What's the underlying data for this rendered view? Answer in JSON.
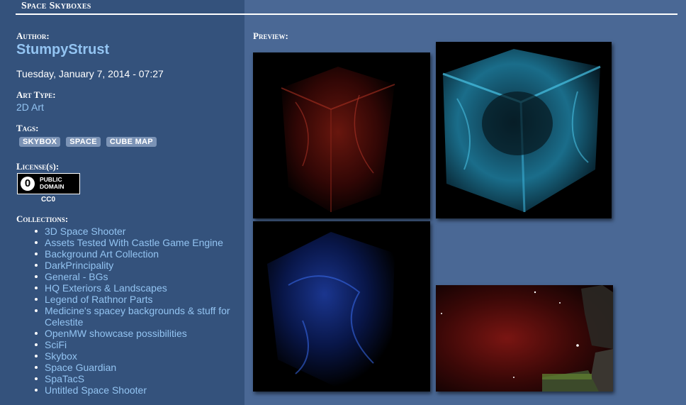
{
  "header": {
    "title": "Space Skyboxes"
  },
  "author": {
    "label": "Author:",
    "name": "StumpyStrust"
  },
  "date": "Tuesday, January 7, 2014 - 07:27",
  "art_type": {
    "label": "Art Type:",
    "value": "2D Art"
  },
  "tags": {
    "label": "Tags:",
    "items": [
      "SKYBOX",
      "SPACE",
      "CUBE MAP"
    ]
  },
  "license": {
    "label": "License(s):",
    "badge_line1": "PUBLIC",
    "badge_line2": "DOMAIN",
    "name": "CC0"
  },
  "collections": {
    "label": "Collections:",
    "items": [
      "3D Space Shooter",
      "Assets Tested With Castle Game Engine",
      "Background Art Collection",
      "DarkPrincipality",
      "General - BGs",
      "HQ Exteriors & Landscapes",
      "Legend of Rathnor Parts",
      "Medicine's spacey backgrounds & stuff for Celestite",
      "OpenMW showcase possibilities",
      "SciFi",
      "Skybox",
      "Space Guardian",
      "SpaTacS",
      "Untitled Space Shooter"
    ]
  },
  "preview": {
    "label": "Preview:"
  },
  "colors": {
    "link": "#93c4f2",
    "sidebar": "#34527c",
    "page": "#4a6895",
    "tag_bg": "#7b93b6"
  }
}
